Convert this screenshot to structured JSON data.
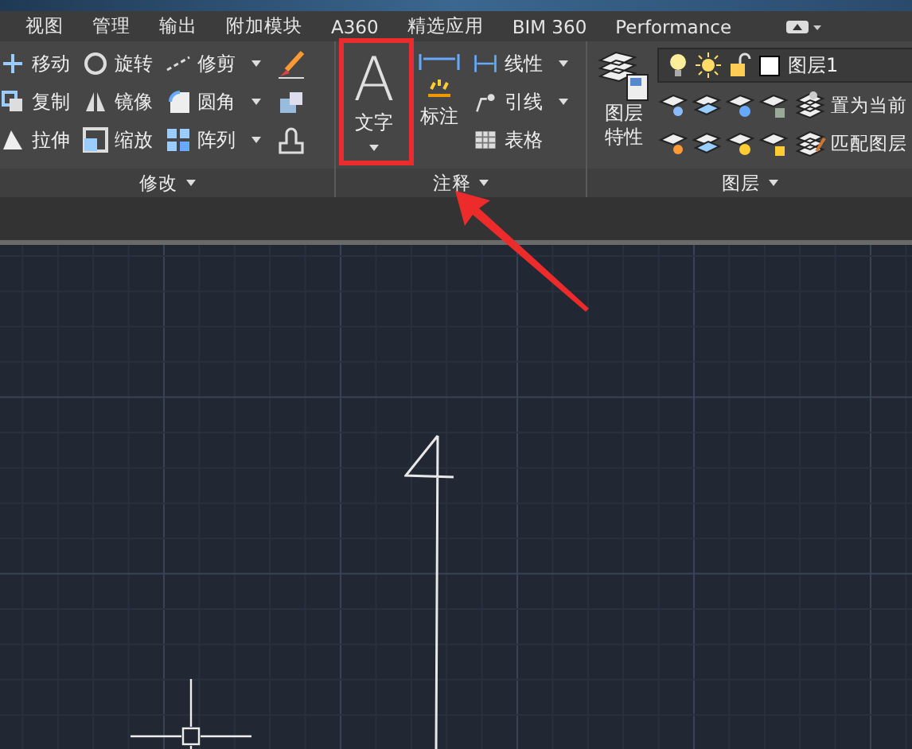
{
  "tabs": [
    {
      "label": "视图",
      "selected": false
    },
    {
      "label": "管理",
      "selected": false
    },
    {
      "label": "输出",
      "selected": false
    },
    {
      "label": "附加模块",
      "selected": false
    },
    {
      "label": "A360",
      "selected": false
    },
    {
      "label": "精选应用",
      "selected": false
    },
    {
      "label": "BIM 360",
      "selected": false
    },
    {
      "label": "Performance",
      "selected": false
    }
  ],
  "ribbon": {
    "modify": {
      "title": "修改",
      "tools": [
        {
          "label": "移动",
          "has_menu": false
        },
        {
          "label": "复制",
          "has_menu": false
        },
        {
          "label": "拉伸",
          "has_menu": false
        },
        {
          "label": "旋转",
          "has_menu": false
        },
        {
          "label": "镜像",
          "has_menu": false
        },
        {
          "label": "缩放",
          "has_menu": false
        },
        {
          "label": "修剪",
          "has_menu": true
        },
        {
          "label": "圆角",
          "has_menu": true
        },
        {
          "label": "阵列",
          "has_menu": true
        }
      ]
    },
    "annotate": {
      "title": "注释",
      "text_button": {
        "glyph": "A",
        "label": "文字",
        "has_menu": true
      },
      "dimension_button": {
        "label": "标注"
      },
      "tools": [
        {
          "label": "线性",
          "has_menu": true
        },
        {
          "label": "引线",
          "has_menu": true
        },
        {
          "label": "表格",
          "has_menu": false
        }
      ]
    },
    "layers": {
      "title": "图层",
      "properties_button": {
        "label_lines": [
          "图层",
          "特性"
        ]
      },
      "layer_field": {
        "value": "图层1"
      },
      "actions": [
        {
          "label": "置为当前"
        },
        {
          "label": "匹配图层"
        }
      ]
    }
  }
}
